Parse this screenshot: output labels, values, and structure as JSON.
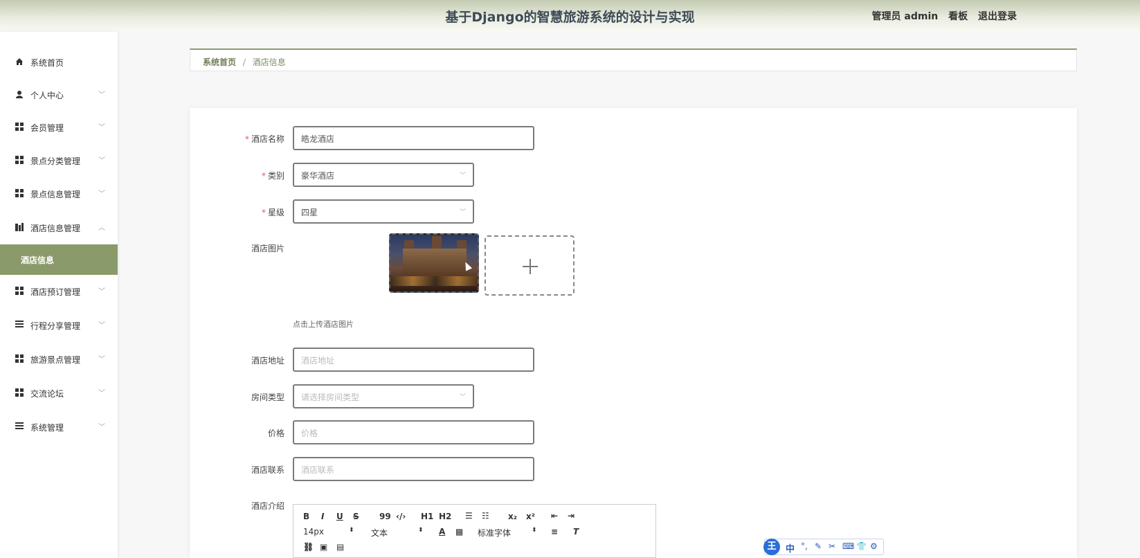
{
  "header": {
    "title": "基于Django的智慧旅游系统的设计与实现",
    "user_label": "管理员 admin",
    "board_label": "看板",
    "logout_label": "退出登录"
  },
  "sidebar": {
    "items": [
      {
        "label": "系统首页",
        "icon": "home-icon"
      },
      {
        "label": "个人中心",
        "icon": "user-icon"
      },
      {
        "label": "会员管理",
        "icon": "grid-icon"
      },
      {
        "label": "景点分类管理",
        "icon": "grid-icon"
      },
      {
        "label": "景点信息管理",
        "icon": "grid-icon"
      },
      {
        "label": "酒店信息管理",
        "icon": "building-icon"
      },
      {
        "label": "酒店信息",
        "icon": ""
      },
      {
        "label": "酒店预订管理",
        "icon": "grid-icon"
      },
      {
        "label": "行程分享管理",
        "icon": "list-icon"
      },
      {
        "label": "旅游景点管理",
        "icon": "grid-icon"
      },
      {
        "label": "交流论坛",
        "icon": "grid-icon"
      },
      {
        "label": "系统管理",
        "icon": "list-icon"
      }
    ]
  },
  "breadcrumb": {
    "home": "系统首页",
    "separator": "/",
    "current": "酒店信息"
  },
  "form": {
    "hotel_name": {
      "label": "酒店名称",
      "value": "皓龙酒店"
    },
    "category": {
      "label": "类别",
      "value": "豪华酒店"
    },
    "star": {
      "label": "星级",
      "value": "四星"
    },
    "image": {
      "label": "酒店图片",
      "hint": "点击上传酒店图片"
    },
    "address": {
      "label": "酒店地址",
      "placeholder": "酒店地址"
    },
    "room_type": {
      "label": "房间类型",
      "placeholder": "请选择房间类型"
    },
    "price": {
      "label": "价格",
      "placeholder": "价格"
    },
    "contact": {
      "label": "酒店联系",
      "placeholder": "酒店联系"
    },
    "intro": {
      "label": "酒店介绍"
    }
  },
  "editor": {
    "bold": "B",
    "italic": "I",
    "underline": "U",
    "strike": "S",
    "quote": "99",
    "code": "‹/›",
    "h1": "H1",
    "h2": "H2",
    "sub": "x₂",
    "sup": "x²",
    "font_size": "14px",
    "header_type": "文本",
    "font_family": "标准字体"
  },
  "ime": {
    "logo": "王",
    "mode": "中"
  }
}
